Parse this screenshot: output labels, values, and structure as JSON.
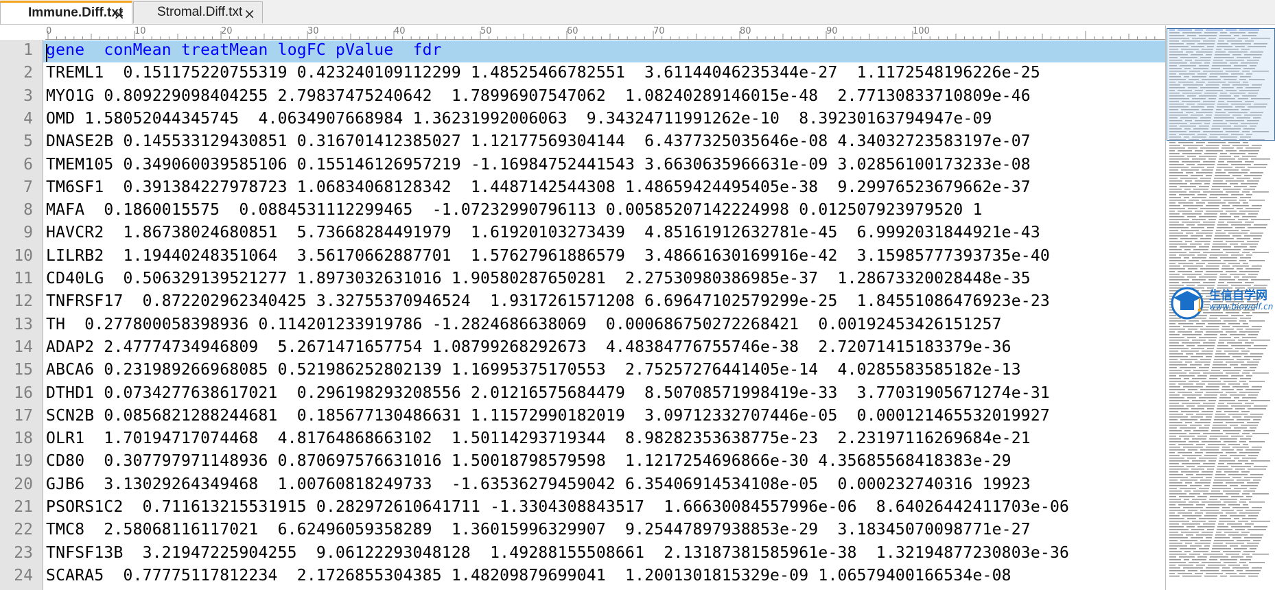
{
  "tabs": [
    {
      "label": "Immune.Diff.txt",
      "active": true
    },
    {
      "label": "Stromal.Diff.txt",
      "active": false
    }
  ],
  "tab_close_glyph": "×",
  "ruler": {
    "labels": [
      "0",
      "10",
      "20",
      "30",
      "40",
      "50",
      "60",
      "70",
      "80",
      "90",
      "100"
    ]
  },
  "editor": {
    "lines": [
      {
        "n": "1",
        "text": "gene\tconMean\ttreatMean\tlogFC\tpValue\tfdr"
      },
      {
        "n": "2",
        "text": "TREML1\t0.151175220755319\t0.423240109112299\t1.48525466782551\t3.61144046235344e-27\t1.1172548196226e-25"
      },
      {
        "n": "3",
        "text": "MYO1G\t0.809229098404255\t2.79837475240642\t1.78996907547062\t1.08240289146015e-48\t2.77130833710809e-46"
      },
      {
        "n": "4",
        "text": "OMD\t1.58052044345745\t4.0634907668984\t1.36231992006063\t9.34324711991262e-10\t8.39230163794947e-09"
      },
      {
        "n": "5",
        "text": "DNASE2B\t0.145533129430851\t0.316701412385027\t1.12177569304144\t6.4377325035646e-08\t4.34032723583197e-07"
      },
      {
        "n": "6",
        "text": "TMEM105\t0.349060039585106\t0.155146126957219\t-1.16984752441543\t3.6630635966631e-09\t3.02856100173233e-08"
      },
      {
        "n": "7",
        "text": "TM6SF1\t0.391384227978723\t1.06834068128342\t1.4487142544308\t1.48659424495405e-38\t9.29976523679662e-37"
      },
      {
        "n": "8",
        "text": "MAFA\t0.1860015575\t0.0884531112299465\t-1.07232990796113\t0.00585207142224998\t0.012507923979520 1"
      },
      {
        "n": "9",
        "text": "HAVCR2\t1.86738024680851\t5.73668284491979\t1.61920103273439\t4.85161912632781e-45\t6.9992031844921e-43"
      },
      {
        "n": "10",
        "text": "LILRB2\t1.19440248351064\t3.56170662887701\t1.57627961886579\t3.48661630169916e-42\t3.15985777393735e-40"
      },
      {
        "n": "11",
        "text": "CD40LG\t0.506329139521277\t1.8973032631016\t1.90580287650281\t2.27530980386985e-37\t1.28673320028448e-35"
      },
      {
        "n": "12",
        "text": "TNFRSF17\t0.872202962340425\t3.32755370946524\t1.9317261571208\t6.69647102579299e-25\t1.84551086476923e-23"
      },
      {
        "n": "13",
        "text": "TH\t0.277800058398936\t0.114201233919786\t-1.2824686638069\t0.000686750272268421\t0.00192453426151257"
      },
      {
        "n": "14",
        "text": "ADAP2\t2.47774734946809\t5.2671471657754\t1.08799268292673\t4.48384776755746e-38\t2.72071415183379e-36"
      },
      {
        "n": "15",
        "text": "ABCA6\t0.231989266968085\t0.521986252802139\t1.16995375170553\t2.75257276441405e-14\t4.0285583585182e-13"
      },
      {
        "n": "16",
        "text": "DTHD1\t0.0734277638617021\t0.296198293208556\t2.01216575684479\t8.50708571998419e-33\t3.77031905671274e-31"
      },
      {
        "n": "17",
        "text": "SCN2B\t0.0856821288244681\t0.185677130486631\t1.11572990182019\t3.09712332707446e-05\t0.000121465532019927"
      },
      {
        "n": "18",
        "text": "OLR1\t1.70194717074468\t4.81764868663102\t1.50114293719344\t8.98282353638775e-23\t2.23197116269684e-21"
      },
      {
        "n": "19",
        "text": "CD80\t0.307797971148936\t0.870697576631016\t1.50018798579598\t1.1217254696866e-30\t4.35685568418383e-29"
      },
      {
        "n": "20",
        "text": "GJB6\t3.13029264349468\t1.00760818249733\t-1.63536279459042\t6.35406914534108e-05\t0.000232740316 19923"
      },
      {
        "n": "21",
        "text": "PSORS1C2\t0.711613215531915\t0.282972610641711\t-1.3304308843517\t1.66630084557996e-06\t8.64026442411703e-06"
      },
      {
        "n": "22",
        "text": "TMC8\t2.58068116117021\t6.62496059358289\t1.36015996329907\t9.25447897938853e-29\t3.18345070098771e-27"
      },
      {
        "n": "23",
        "text": "TNFSF13B\t3.21947225904255\t9.06122293048128\t1.49288155508661\t2.13187381585961e-38\t1.32194877230803e-36"
      },
      {
        "n": "24",
        "text": "SCARA5\t0.77775117812234\t2.1726855304385\t1.48209879699041\t1.2001301815329e-09\t1.06579400166534e-08"
      }
    ]
  },
  "watermark": {
    "title": "生信自学网",
    "url": "www.biowolf.cn"
  }
}
